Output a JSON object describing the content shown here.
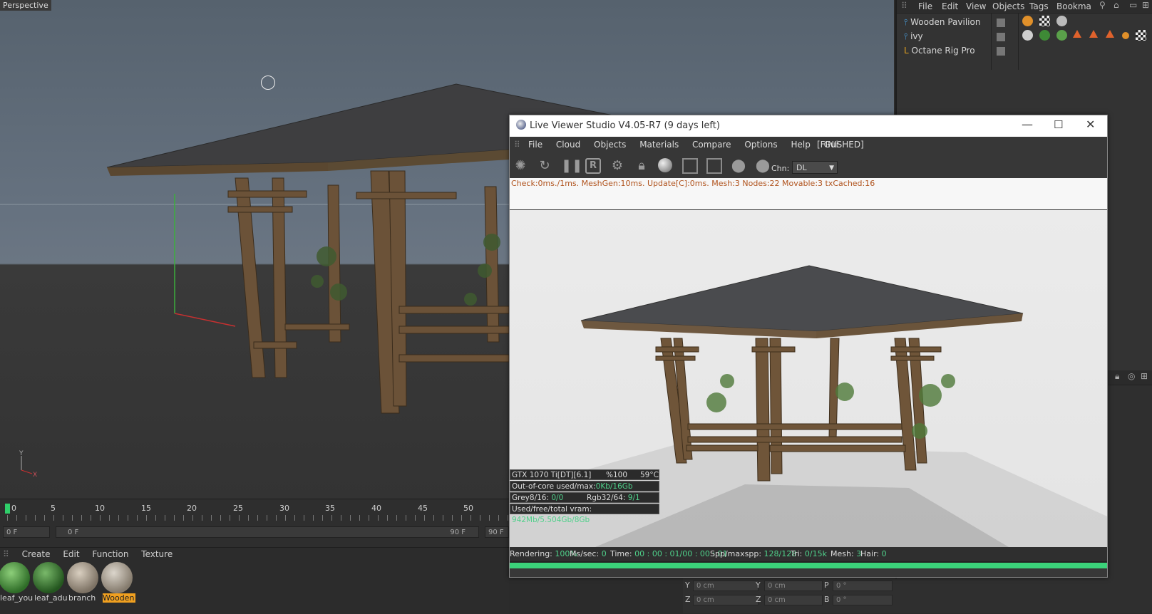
{
  "viewport": {
    "label": "Perspective",
    "axis_y": "Y",
    "axis_x": "X"
  },
  "timeline": {
    "ticks": [
      "0",
      "5",
      "10",
      "15",
      "20",
      "25",
      "30",
      "35",
      "40",
      "45",
      "50"
    ],
    "current_frame": "0 F",
    "start_frame": "0 F",
    "end_frame_inner": "90 F",
    "end_frame": "90 F"
  },
  "material_manager": {
    "menu": [
      "Create",
      "Edit",
      "Function",
      "Texture"
    ],
    "materials": [
      {
        "label": "leaf_you",
        "selected": false
      },
      {
        "label": "leaf_adu",
        "selected": false
      },
      {
        "label": "branch",
        "selected": false
      },
      {
        "label": "Wooden",
        "selected": true
      }
    ]
  },
  "object_manager": {
    "menu": [
      "File",
      "Edit",
      "View",
      "Objects",
      "Tags",
      "Bookma"
    ],
    "objects": [
      {
        "name": "Wooden Pavilion",
        "icon": "null-object-icon"
      },
      {
        "name": "ivy",
        "icon": "null-object-icon"
      },
      {
        "name": "Octane Rig Pro",
        "icon": "layer-object-icon"
      }
    ]
  },
  "attributes": {
    "rows": [
      {
        "a_label": "Y",
        "a_val": "0 cm",
        "b_label": "Y",
        "b_val": "0 cm",
        "c_label": "P",
        "c_val": "0 °"
      },
      {
        "a_label": "Z",
        "a_val": "0 cm",
        "b_label": "Z",
        "b_val": "0 cm",
        "c_label": "B",
        "c_val": "0 °"
      }
    ]
  },
  "live_viewer": {
    "title": "Live Viewer Studio V4.05-R7 (9 days left)",
    "menu": [
      "File",
      "Cloud",
      "Objects",
      "Materials",
      "Compare",
      "Options",
      "Help",
      "Gui"
    ],
    "state": "[FINISHED]",
    "channel_label": "Chn:",
    "channel_value": "DL",
    "status_line": "Check:0ms./1ms. MeshGen:10ms. Update[C]:0ms. Mesh:3 Nodes:22 Movable:3 txCached:16",
    "gpu": {
      "name": "GTX 1070 Ti[DT][6.1]",
      "usage": "%100",
      "temp": "59°C",
      "ooc_label": "Out-of-core used/max:",
      "ooc_value": "0Kb/16Gb",
      "grey_label": "Grey8/16:",
      "grey_value": "0/0",
      "rgb_label": "Rgb32/64:",
      "rgb_value": "9/1",
      "vram_label": "Used/free/total vram:",
      "vram_value": "942Mb/5.504Gb/8Gb"
    },
    "footer": {
      "rendering_label": "Rendering:",
      "rendering_value": "100%",
      "ms_label": "Ms/sec:",
      "ms_value": "0",
      "time_label": "Time:",
      "time_value": "00 : 00 : 01/00 : 00 : 01",
      "spp_label": "Spp/maxspp:",
      "spp_value": "128/128",
      "tri_label": "Tri:",
      "tri_value": "0/15k",
      "mesh_label": "Mesh:",
      "mesh_value": "3",
      "hair_label": "Hair:",
      "hair_value": "0"
    },
    "progress": 1.0
  },
  "colors": {
    "accent_green": "#3bd37a",
    "status_orange": "#b0531d",
    "selected_material": "#f0a020"
  }
}
